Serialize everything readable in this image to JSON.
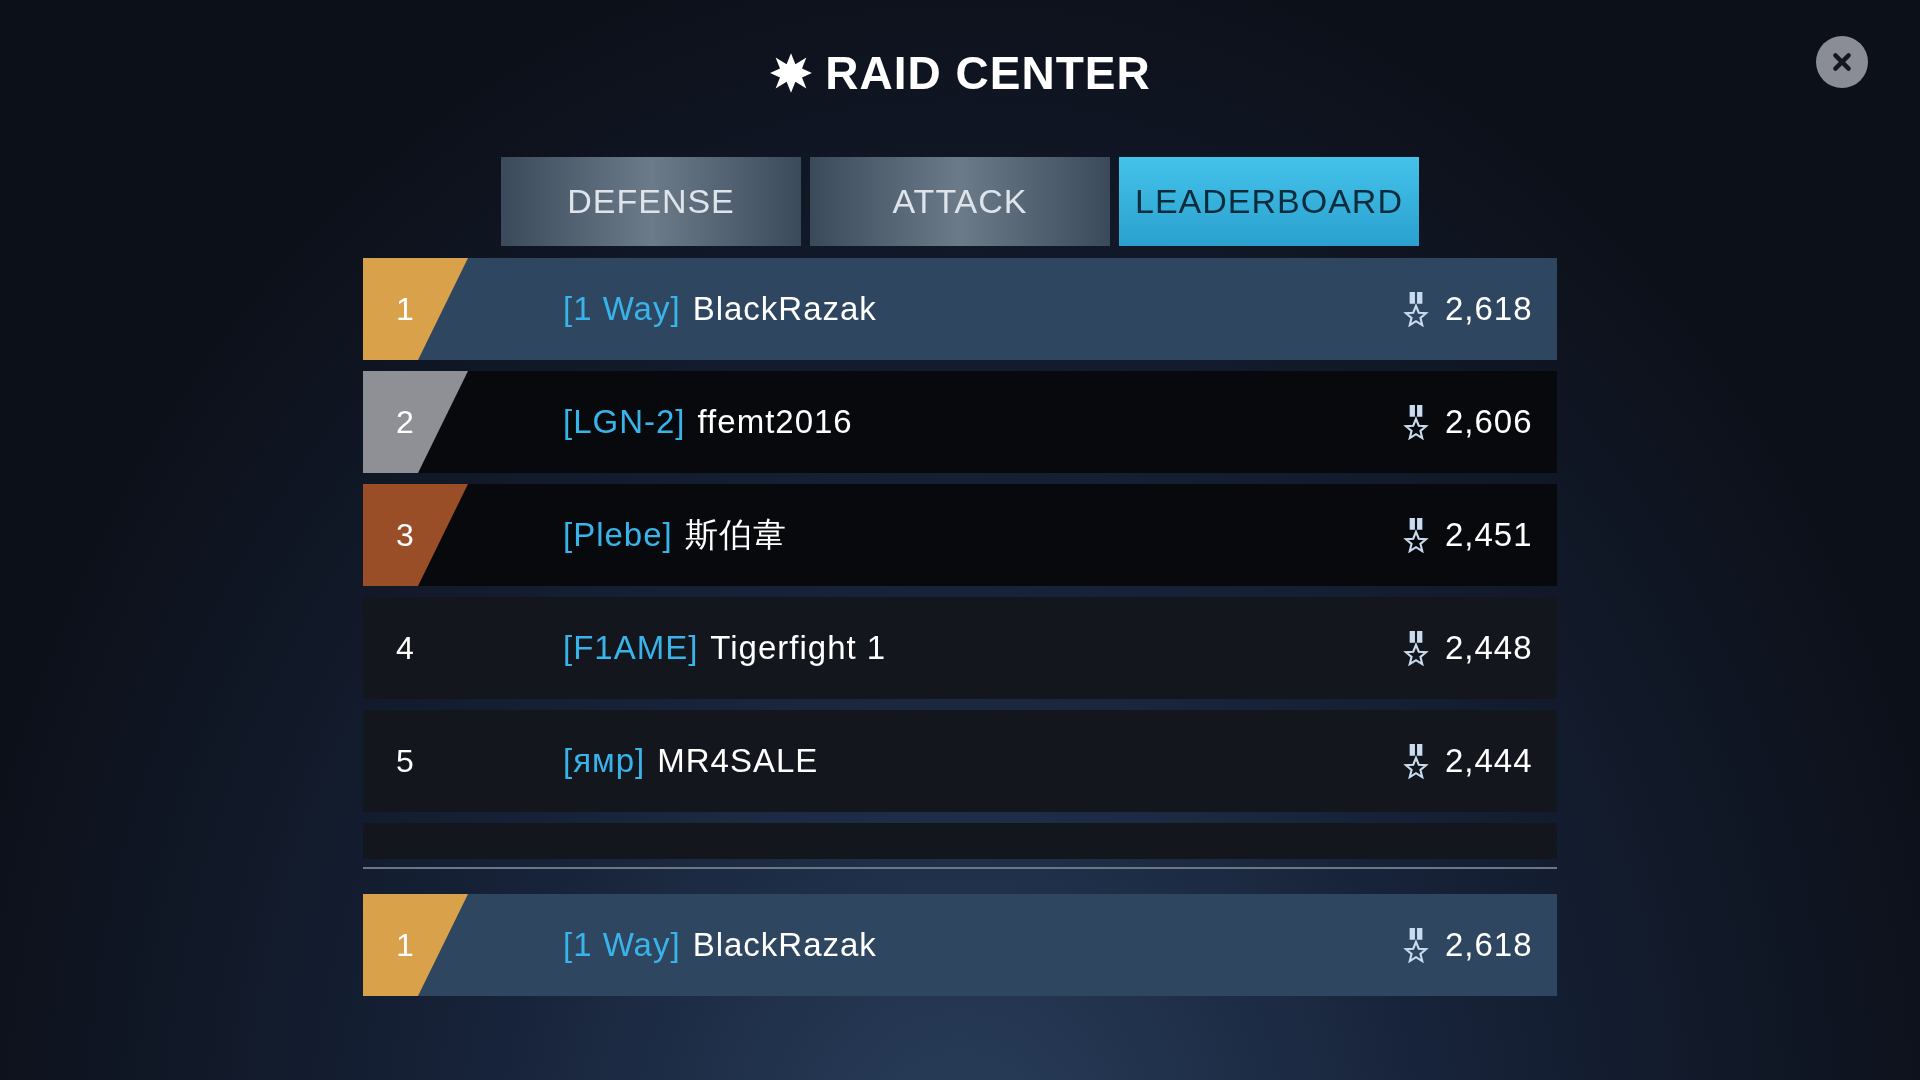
{
  "title": "RAID CENTER",
  "tabs": [
    {
      "label": "DEFENSE",
      "selected": false
    },
    {
      "label": "ATTACK",
      "selected": false
    },
    {
      "label": "LEADERBOARD",
      "selected": true
    }
  ],
  "rows": [
    {
      "rank": "1",
      "color": "#d9a24a",
      "tag": "[1 Way]",
      "name": "BlackRazak",
      "score": "2,618",
      "selected": true
    },
    {
      "rank": "2",
      "color": "#8e9096",
      "tag": "[LGN-2]",
      "name": "ffemt2016",
      "score": "2,606",
      "selected": false
    },
    {
      "rank": "3",
      "color": "#9a4e28",
      "tag": "[Plebe]",
      "name": "斯伯韋",
      "score": "2,451",
      "selected": false
    },
    {
      "rank": "4",
      "tag": "[F1AME]",
      "name": "Tigerfight 1",
      "score": "2,448",
      "selected": false
    },
    {
      "rank": "5",
      "tag": "[ямр]",
      "name": "MR4SALE",
      "score": "2,444",
      "selected": false
    }
  ],
  "own_row": {
    "rank": "1",
    "color": "#d9a24a",
    "tag": "[1 Way]",
    "name": "BlackRazak",
    "score": "2,618",
    "selected": true
  }
}
